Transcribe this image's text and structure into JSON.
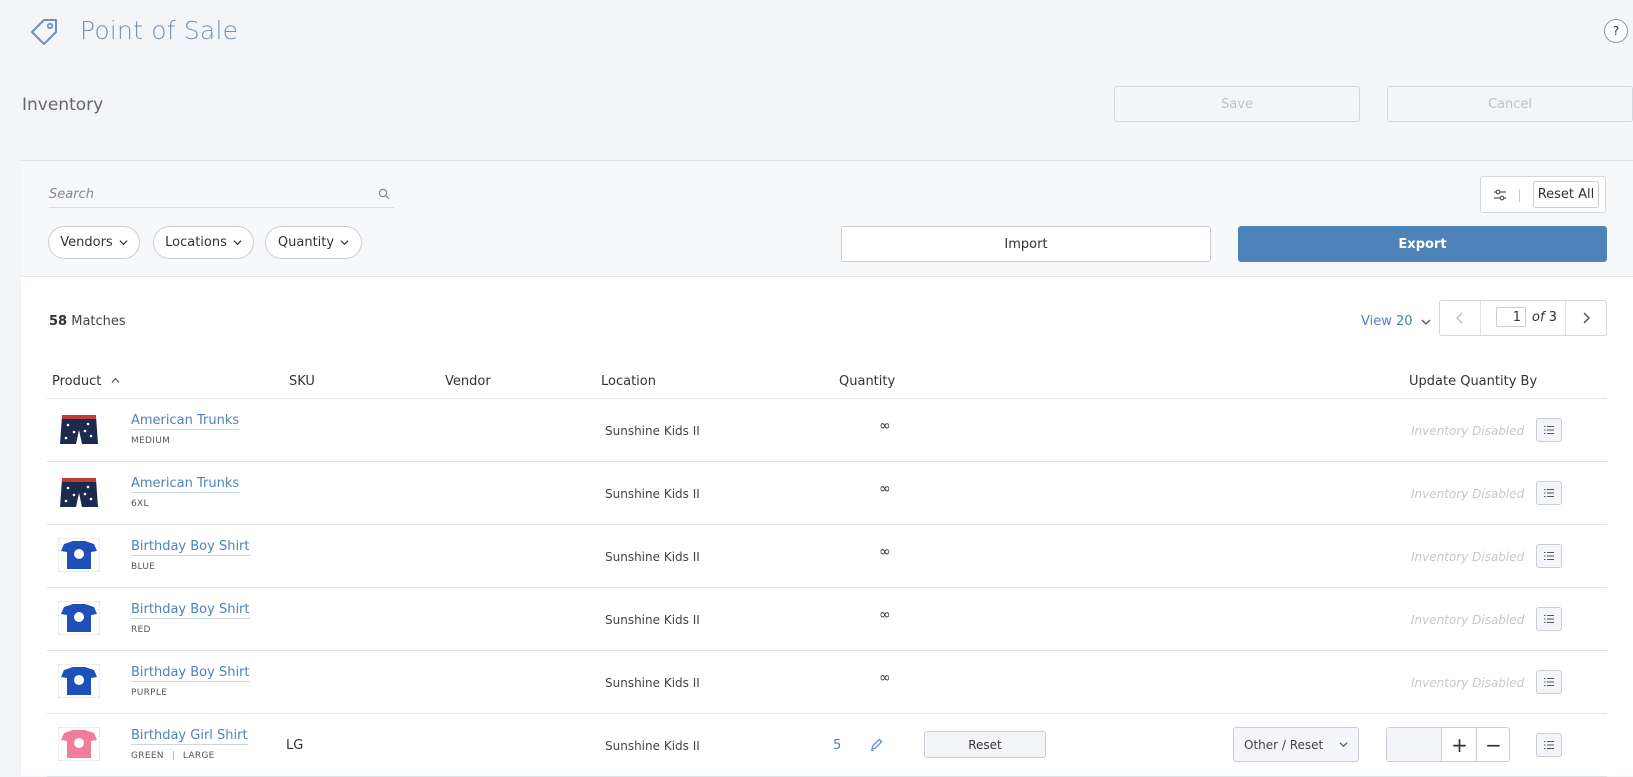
{
  "header": {
    "title": "Point of Sale",
    "help": "?"
  },
  "section": {
    "title": "Inventory",
    "save_label": "Save",
    "cancel_label": "Cancel"
  },
  "filters": {
    "search_placeholder": "Search",
    "vendors": "Vendors",
    "locations": "Locations",
    "quantity": "Quantity",
    "reset_all": "Reset All",
    "import": "Import",
    "export": "Export"
  },
  "results": {
    "count": "58",
    "matches_label": "Matches",
    "view": "View 20",
    "page": "1",
    "of_label": "of",
    "total_pages": "3"
  },
  "columns": {
    "product": "Product",
    "sku": "SKU",
    "vendor": "Vendor",
    "location": "Location",
    "quantity": "Quantity",
    "update": "Update Quantity By"
  },
  "rows": [
    {
      "name": "American Trunks",
      "variant": "MEDIUM",
      "sku": "",
      "location": "Sunshine Kids II",
      "quantity": "∞",
      "status": "Inventory Disabled",
      "thumb": "trunks"
    },
    {
      "name": "American Trunks",
      "variant": "6XL",
      "sku": "",
      "location": "Sunshine Kids II",
      "quantity": "∞",
      "status": "Inventory Disabled",
      "thumb": "trunks"
    },
    {
      "name": "Birthday Boy Shirt",
      "variant": "BLUE",
      "sku": "",
      "location": "Sunshine Kids II",
      "quantity": "∞",
      "status": "Inventory Disabled",
      "thumb": "blue-shirt"
    },
    {
      "name": "Birthday Boy Shirt",
      "variant": "RED",
      "sku": "",
      "location": "Sunshine Kids II",
      "quantity": "∞",
      "status": "Inventory Disabled",
      "thumb": "blue-shirt"
    },
    {
      "name": "Birthday Boy Shirt",
      "variant": "PURPLE",
      "sku": "",
      "location": "Sunshine Kids II",
      "quantity": "∞",
      "status": "Inventory Disabled",
      "thumb": "blue-shirt"
    },
    {
      "name": "Birthday Girl Shirt",
      "variant": "GREEN",
      "variant2": "LARGE",
      "sku": "LG",
      "location": "Sunshine Kids II",
      "quantity": "5",
      "reset": "Reset",
      "update_mode": "Other / Reset",
      "thumb": "pink-shirt"
    }
  ],
  "colors": {
    "accent": "#4e83ba",
    "title": "#6f91b6",
    "background": "#f4f5f8"
  }
}
